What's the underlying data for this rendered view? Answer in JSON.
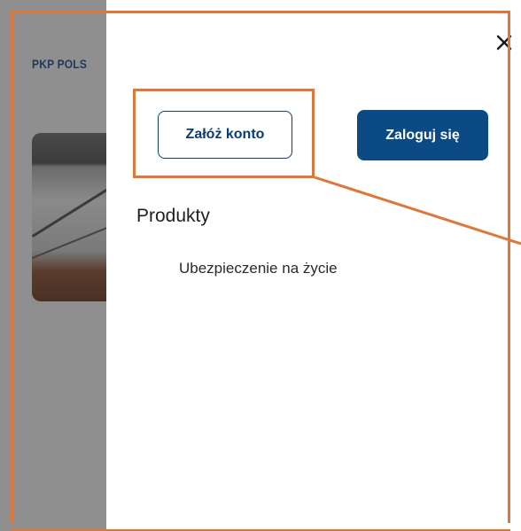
{
  "background_page": {
    "logo_text": "PKP POLS"
  },
  "drawer": {
    "close_label": "×",
    "register_button_label": "Załóż konto",
    "login_button_label": "Zaloguj się",
    "section_title": "Produkty",
    "menu_items": [
      {
        "label": "Ubezpieczenie na życie"
      }
    ]
  },
  "colors": {
    "primary": "#0b4a85",
    "annotation": "#e0773a",
    "overlay": "#8f8f8f"
  }
}
